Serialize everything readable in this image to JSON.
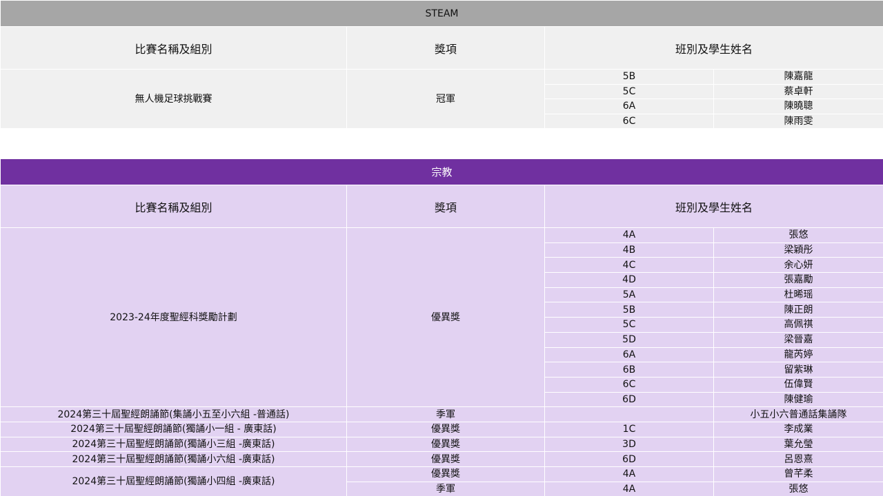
{
  "steam": {
    "title": "STEAM",
    "headers": {
      "competition": "比賽名稱及組別",
      "award": "獎項",
      "students": "班別及學生姓名"
    },
    "entry": {
      "competition": "無人機足球挑戰賽",
      "award": "冠軍",
      "students": [
        {
          "class": "5B",
          "name": "陳嘉龍"
        },
        {
          "class": "5C",
          "name": "蔡卓軒"
        },
        {
          "class": "6A",
          "name": "陳曉聰"
        },
        {
          "class": "6C",
          "name": "陳雨雯"
        }
      ]
    }
  },
  "religion": {
    "title": "宗教",
    "headers": {
      "competition": "比賽名稱及組別",
      "award": "獎項",
      "students": "班別及學生姓名"
    },
    "bible_award": {
      "competition": "2023-24年度聖經科獎勵計劃",
      "award": "優異獎",
      "students": [
        {
          "class": "4A",
          "name": "張悠"
        },
        {
          "class": "4B",
          "name": "梁穎彤"
        },
        {
          "class": "4C",
          "name": "余心妍"
        },
        {
          "class": "4D",
          "name": "張嘉勵"
        },
        {
          "class": "5A",
          "name": "杜晞瑶"
        },
        {
          "class": "5B",
          "name": "陳正朗"
        },
        {
          "class": "5C",
          "name": "高佩祺"
        },
        {
          "class": "5D",
          "name": "梁晉嘉"
        },
        {
          "class": "6A",
          "name": "龍芮婷"
        },
        {
          "class": "6B",
          "name": "留紫琳"
        },
        {
          "class": "6C",
          "name": "伍偉賢"
        },
        {
          "class": "6D",
          "name": "陳健瑜"
        }
      ]
    },
    "recital_group": {
      "competition": "2024第三十屆聖經朗誦節(集誦小五至小六組 -普通話)",
      "award": "季軍",
      "team": "小五小六普通話集誦隊"
    },
    "recital_p1": {
      "competition": "2024第三十屆聖經朗誦節(獨誦小一組 - 廣東話)",
      "award": "優異獎",
      "class": "1C",
      "name": "李成業"
    },
    "recital_p3": {
      "competition": "2024第三十屆聖經朗誦節(獨誦小三組 -廣東話)",
      "award": "優異獎",
      "class": "3D",
      "name": "葉允瑩"
    },
    "recital_p6": {
      "competition": "2024第三十屆聖經朗誦節(獨誦小六組 -廣東話)",
      "award": "優異獎",
      "class": "6D",
      "name": "呂恩熹"
    },
    "recital_p4": {
      "competition": "2024第三十屆聖經朗誦節(獨誦小四組 -廣東話)",
      "entries": [
        {
          "award": "優異獎",
          "class": "4A",
          "name": "曾芊柔"
        },
        {
          "award": "季軍",
          "class": "4A",
          "name": "張悠"
        }
      ]
    }
  }
}
